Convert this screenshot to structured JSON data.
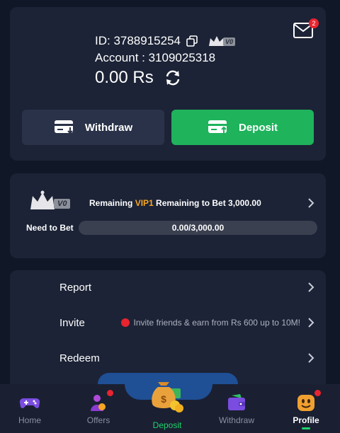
{
  "account": {
    "id_text": "ID: 3788915254",
    "vip_level_small": "V0",
    "account_text": "Account : 3109025318",
    "balance": "0.00",
    "currency": "Rs",
    "mail_count": "2"
  },
  "actions": {
    "withdraw_label": "Withdraw",
    "deposit_label": "Deposit"
  },
  "vip": {
    "level": "V0",
    "remaining_prefix": "Remaining",
    "next_level": "VIP1",
    "remaining_suffix": "Remaining to Bet 3,000.00",
    "need_label": "Need to Bet",
    "progress_text": "0.00/3,000.00",
    "progress_fraction": 0
  },
  "menu": {
    "items": [
      {
        "label": "Report",
        "note": ""
      },
      {
        "label": "Invite",
        "note": "Invite friends & earn from Rs 600 up to 10M!"
      },
      {
        "label": "Redeem",
        "note": ""
      }
    ]
  },
  "nav": {
    "home": "Home",
    "offers": "Offers",
    "deposit": "Deposit",
    "withdraw": "Withdraw",
    "profile": "Profile"
  },
  "colors": {
    "accent_green": "#1fb35c",
    "gold": "#f6a623",
    "badge_red": "#e8242f",
    "card_bg": "#1c2336"
  }
}
